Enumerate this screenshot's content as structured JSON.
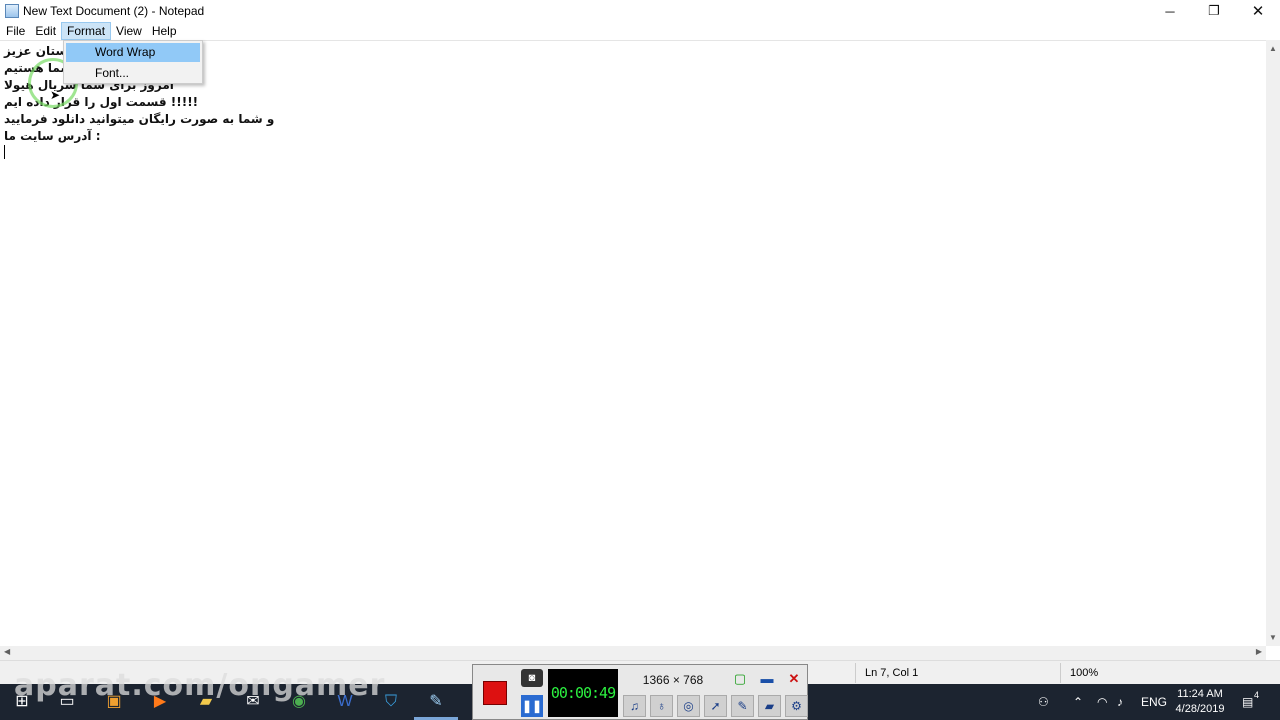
{
  "window": {
    "title": "New Text Document (2) - Notepad",
    "minimize_glyph": "─",
    "maximize_glyph": "❐",
    "close_glyph": "✕"
  },
  "menu": {
    "items": [
      {
        "label": "File"
      },
      {
        "label": "Edit"
      },
      {
        "label": "Format"
      },
      {
        "label": "View"
      },
      {
        "label": "Help"
      }
    ],
    "open_menu": "Format",
    "dropdown": [
      {
        "label": "Word Wrap",
        "highlighted": true
      },
      {
        "label": "Font...",
        "highlighted": false
      }
    ]
  },
  "document": {
    "lines": [
      "دوستان عزیز",
      "ما در خدمت شما هستیم",
      "امروز برای شما سریال هیولا",
      "!!!!!  قسمت اول را قرار داده ایم",
      "و شما به صورت رایگان میتوانید دانلود فرمایید",
      ":  آدرس سایت ما"
    ]
  },
  "status": {
    "position": "Ln 7, Col 1",
    "zoom": "100%"
  },
  "recorder": {
    "timer": "00:00:49",
    "resolution": "1366 × 768",
    "record_color": "#dd1111",
    "timer_color": "#2cf040"
  },
  "taskbar": {
    "time": "11:24 AM",
    "date": "4/28/2019",
    "language": "ENG",
    "notification_count": "4",
    "pinned_icons": [
      "windows-start-icon",
      "task-view-icon",
      "store-icon",
      "media-player-icon",
      "file-explorer-icon",
      "mail-icon",
      "chrome-icon",
      "word-icon",
      "security-icon",
      "notepad-icon"
    ]
  },
  "watermark": "aparat.com/ongamer"
}
